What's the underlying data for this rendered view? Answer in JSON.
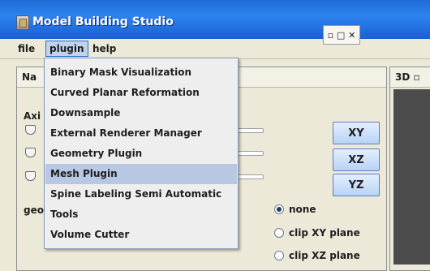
{
  "window": {
    "title": "Model Building Studio"
  },
  "menubar": {
    "items": [
      "file",
      "plugin",
      "help"
    ],
    "active": "plugin"
  },
  "plugin_menu": {
    "items": [
      "Binary Mask Visualization",
      "Curved Planar Reformation",
      "Downsample",
      "External Renderer Manager",
      "Geometry Plugin",
      "Mesh Plugin",
      "Spine Labeling Semi Automatic",
      "Tools",
      "Volume Cutter"
    ],
    "highlighted": "Mesh Plugin"
  },
  "left_panel": {
    "tab_label": "Na",
    "axis_label": "Axi",
    "geometry_label": "geo",
    "controls": "▫ □ ✕"
  },
  "right_panel": {
    "tab_label": "3D ▫"
  },
  "view_buttons": [
    "XY",
    "XZ",
    "YZ"
  ],
  "clip_options": {
    "items": [
      "none",
      "clip XY plane",
      "clip XZ plane"
    ],
    "selected": "none"
  }
}
